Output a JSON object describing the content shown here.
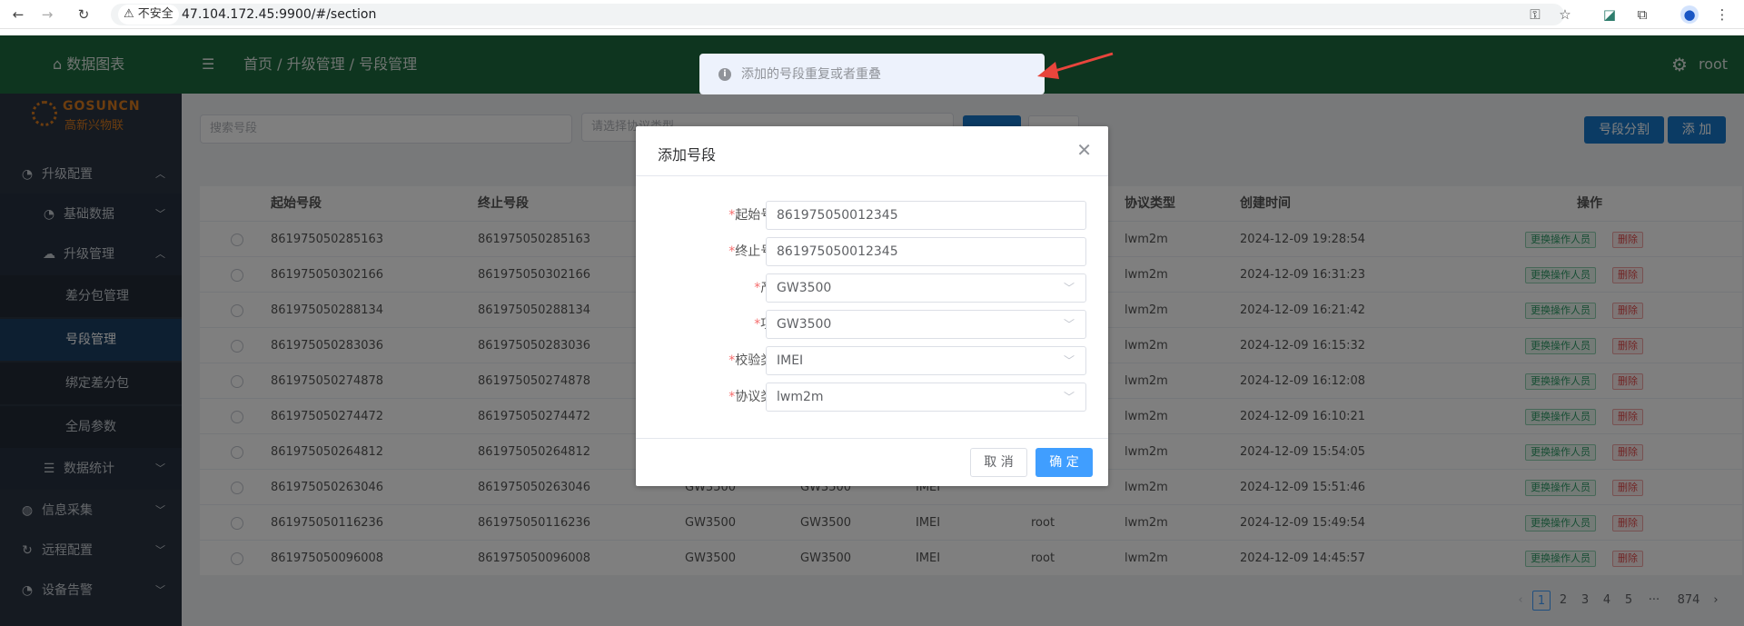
{
  "browser": {
    "security_label": "不安全",
    "url": "47.104.172.45:9900/#/section"
  },
  "header": {
    "brand": "数据图表",
    "breadcrumb": [
      "首页",
      "升级管理",
      "号段管理"
    ],
    "user": "root"
  },
  "logo": {
    "text": "GOSUNCN",
    "sub": "高新兴物联"
  },
  "sidebar": {
    "items": [
      {
        "label": "升级配置",
        "icon": "clock-icon",
        "expanded": true
      },
      {
        "label": "基础数据",
        "icon": "chart-icon"
      },
      {
        "label": "升级管理",
        "icon": "cloud-icon",
        "expanded": true
      },
      {
        "label": "差分包管理"
      },
      {
        "label": "号段管理",
        "active": true
      },
      {
        "label": "绑定差分包"
      },
      {
        "label": "全局参数"
      },
      {
        "label": "数据统计",
        "icon": "list-icon"
      },
      {
        "label": "信息采集",
        "icon": "globe-icon"
      },
      {
        "label": "远程配置",
        "icon": "refresh-icon"
      },
      {
        "label": "设备告警",
        "icon": "bell-icon"
      }
    ]
  },
  "toolbar": {
    "search_placeholder": "搜索号段",
    "type_placeholder": "请选择协议类型",
    "split_label": "号段分割",
    "add_label": "添 加"
  },
  "table": {
    "columns": [
      "起始号段",
      "终止号段",
      "协议类型",
      "创建时间",
      "操作"
    ],
    "op_change_label": "更换操作人员",
    "op_delete_label": "删除",
    "rows": [
      {
        "start": "861975050285163",
        "end": "861975050285163",
        "product": "",
        "project": "",
        "check": "",
        "user": "",
        "protocol": "lwm2m",
        "created": "2024-12-09 19:28:54"
      },
      {
        "start": "861975050302166",
        "end": "861975050302166",
        "product": "",
        "project": "",
        "check": "",
        "user": "",
        "protocol": "lwm2m",
        "created": "2024-12-09 16:31:23"
      },
      {
        "start": "861975050288134",
        "end": "861975050288134",
        "product": "",
        "project": "",
        "check": "",
        "user": "",
        "protocol": "lwm2m",
        "created": "2024-12-09 16:21:42"
      },
      {
        "start": "861975050283036",
        "end": "861975050283036",
        "product": "",
        "project": "",
        "check": "",
        "user": "",
        "protocol": "lwm2m",
        "created": "2024-12-09 16:15:32"
      },
      {
        "start": "861975050274878",
        "end": "861975050274878",
        "product": "",
        "project": "",
        "check": "",
        "user": "",
        "protocol": "lwm2m",
        "created": "2024-12-09 16:12:08"
      },
      {
        "start": "861975050274472",
        "end": "861975050274472",
        "product": "",
        "project": "",
        "check": "",
        "user": "",
        "protocol": "lwm2m",
        "created": "2024-12-09 16:10:21"
      },
      {
        "start": "861975050264812",
        "end": "861975050264812",
        "product": "",
        "project": "",
        "check": "",
        "user": "",
        "protocol": "lwm2m",
        "created": "2024-12-09 15:54:05"
      },
      {
        "start": "861975050263046",
        "end": "861975050263046",
        "product": "GW3500",
        "project": "GW3500",
        "check": "IMEI",
        "user": "",
        "protocol": "lwm2m",
        "created": "2024-12-09 15:51:46"
      },
      {
        "start": "861975050116236",
        "end": "861975050116236",
        "product": "GW3500",
        "project": "GW3500",
        "check": "IMEI",
        "user": "root",
        "protocol": "lwm2m",
        "created": "2024-12-09 15:49:54"
      },
      {
        "start": "861975050096008",
        "end": "861975050096008",
        "product": "GW3500",
        "project": "GW3500",
        "check": "IMEI",
        "user": "root",
        "protocol": "lwm2m",
        "created": "2024-12-09 14:45:57"
      }
    ]
  },
  "pagination": {
    "pages": [
      "1",
      "2",
      "3",
      "4",
      "5",
      "···",
      "874"
    ],
    "current": "1"
  },
  "dialog": {
    "title": "添加号段",
    "fields": [
      {
        "label": "起始号段:",
        "value": "861975050012345",
        "select": false
      },
      {
        "label": "终止号段:",
        "value": "861975050012345",
        "select": false
      },
      {
        "label": "产品:",
        "value": "GW3500",
        "select": true
      },
      {
        "label": "项目:",
        "value": "GW3500",
        "select": true
      },
      {
        "label": "校验类型:",
        "value": "IMEI",
        "select": true
      },
      {
        "label": "协议类型:",
        "value": "lwm2m",
        "select": true
      }
    ],
    "cancel_label": "取 消",
    "ok_label": "确 定"
  },
  "toast": {
    "message": "添加的号段重复或者重叠"
  },
  "colors": {
    "header": "#1d6a3e",
    "sidebar": "#2a3443",
    "primary": "#409eff",
    "arrow": "#e8453c"
  }
}
